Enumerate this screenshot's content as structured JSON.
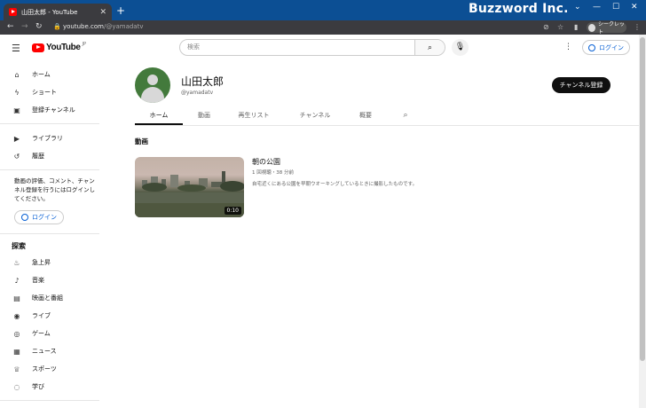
{
  "browser": {
    "tab_title": "山田太郎 - YouTube",
    "new_tab": "+",
    "brand_overlay": "Buzzword Inc.",
    "url_host": "youtube.com",
    "url_path": "/@yamadatv",
    "incognito_label": "シークレット"
  },
  "header": {
    "logo_text": "YouTube",
    "logo_sup": "JP",
    "search_placeholder": "検索",
    "login_label": "ログイン"
  },
  "sidebar": {
    "main": [
      {
        "icon": "home-icon",
        "label": "ホーム"
      },
      {
        "icon": "shorts-icon",
        "label": "ショート"
      },
      {
        "icon": "subscriptions-icon",
        "label": "登録チャンネル"
      }
    ],
    "library": [
      {
        "icon": "library-icon",
        "label": "ライブラリ"
      },
      {
        "icon": "history-icon",
        "label": "履歴"
      }
    ],
    "signin_message": "動画の評価、コメント、チャンネル登録を行うにはログインしてください。",
    "login_label": "ログイン",
    "explore_title": "探索",
    "explore": [
      {
        "icon": "trending-icon",
        "label": "急上昇"
      },
      {
        "icon": "music-icon",
        "label": "音楽"
      },
      {
        "icon": "movies-icon",
        "label": "映画と番組"
      },
      {
        "icon": "live-icon",
        "label": "ライブ"
      },
      {
        "icon": "gaming-icon",
        "label": "ゲーム"
      },
      {
        "icon": "news-icon",
        "label": "ニュース"
      },
      {
        "icon": "sports-icon",
        "label": "スポーツ"
      },
      {
        "icon": "learning-icon",
        "label": "学び"
      }
    ]
  },
  "channel": {
    "name": "山田太郎",
    "handle": "@yamadatv",
    "subscribe_label": "チャンネル登録",
    "tabs": [
      "ホーム",
      "動画",
      "再生リスト",
      "チャンネル",
      "概要"
    ],
    "active_tab": "ホーム"
  },
  "content": {
    "section_title": "動画",
    "video": {
      "title": "朝の公園",
      "meta": "1 回視聴・38 分前",
      "description": "自宅近くにある公園を早朝ウオーキングしているときに撮影したものです。",
      "duration": "0:10"
    }
  },
  "colors": {
    "title_bar": "#0c4f94",
    "youtube_red": "#ff0000",
    "link_blue": "#065fd4"
  }
}
